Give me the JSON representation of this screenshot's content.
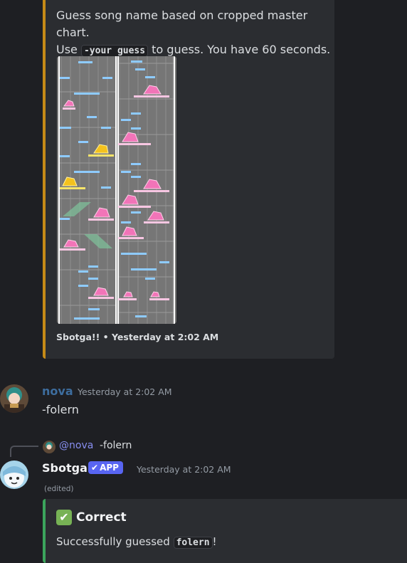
{
  "quiz_embed": {
    "line1": "Guess song name based on cropped master chart.",
    "line2_prefix": "Use ",
    "command": "-your guess",
    "line2_suffix": " to guess. You have 60 seconds.",
    "footer": "Sbotga!! • Yesterday at 2:02 AM"
  },
  "message_nova": {
    "username": "nova",
    "timestamp": "Yesterday at 2:02 AM",
    "text": "-folern",
    "username_color": "#3d6d9e"
  },
  "bot_reply": {
    "mention": "@nova",
    "quoted": "-folern",
    "username": "Sbotga",
    "badge": "APP",
    "timestamp": "Yesterday at 2:02 AM",
    "edited": "(edited)"
  },
  "result_embed": {
    "title": "Correct",
    "desc_prefix": "Successfully guessed ",
    "answer": "folern",
    "desc_suffix": "!",
    "accent": "#3ba55c"
  },
  "colors": {
    "quiz_accent": "#c58a17",
    "background": "#1e1f23",
    "embed_bg": "#2b2d31"
  }
}
